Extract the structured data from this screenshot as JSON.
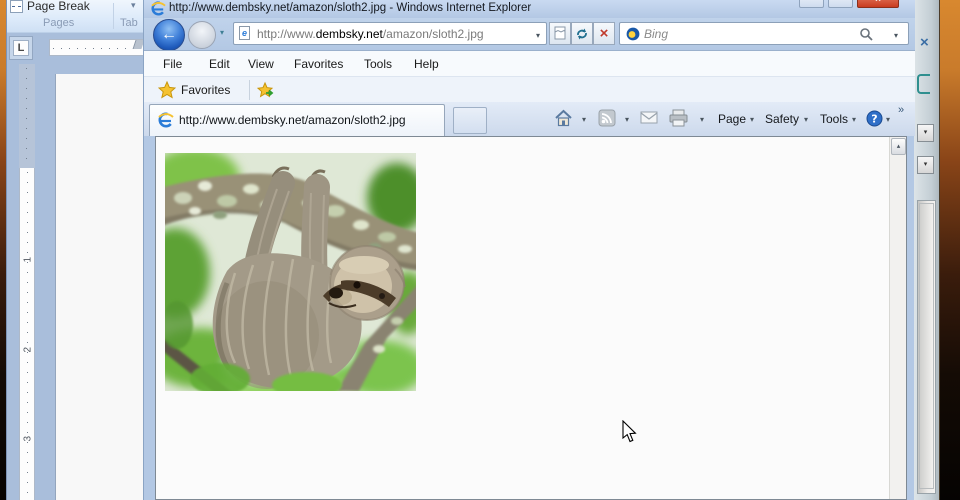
{
  "glyphs": {
    "dropdown": "▾",
    "up_arrow": "▴",
    "close": "×",
    "overflow": "»",
    "back_arrow": "←",
    "stop": "×",
    "help": "?",
    "separator": "|"
  },
  "colors": {
    "titlebar": "#b7cce8",
    "close_button_red": "#c94a2e",
    "desktop_orange": "#d8882f",
    "accent_blue": "#2b6cc8",
    "bing_blue": "#1958a8",
    "star_gold": "#f5c231",
    "content_bg": "#fbfbfb",
    "word_bg": "#a9bedb"
  },
  "ie": {
    "title": "http://www.dembsky.net/amazon/sloth2.jpg - Windows Internet Explorer",
    "address": {
      "prefix": "http://www.",
      "domain": "dembsky.net",
      "path": "/amazon/sloth2.jpg"
    },
    "search": {
      "engine_label": "Bing"
    },
    "menu": [
      "File",
      "Edit",
      "View",
      "Favorites",
      "Tools",
      "Help"
    ],
    "favorites_bar": {
      "label": "Favorites"
    },
    "tab": {
      "title": "http://www.dembsky.net/amazon/sloth2.jpg"
    },
    "command_bar": {
      "page": "Page",
      "safety": "Safety",
      "tools": "Tools"
    }
  },
  "word": {
    "ribbon": {
      "page_break": "Page Break",
      "pages_group": "Pages",
      "tables_group": "Tab"
    },
    "tab_selector": "L",
    "vertical_ruler": {
      "numbers": [
        "1",
        "2",
        "3"
      ]
    }
  }
}
